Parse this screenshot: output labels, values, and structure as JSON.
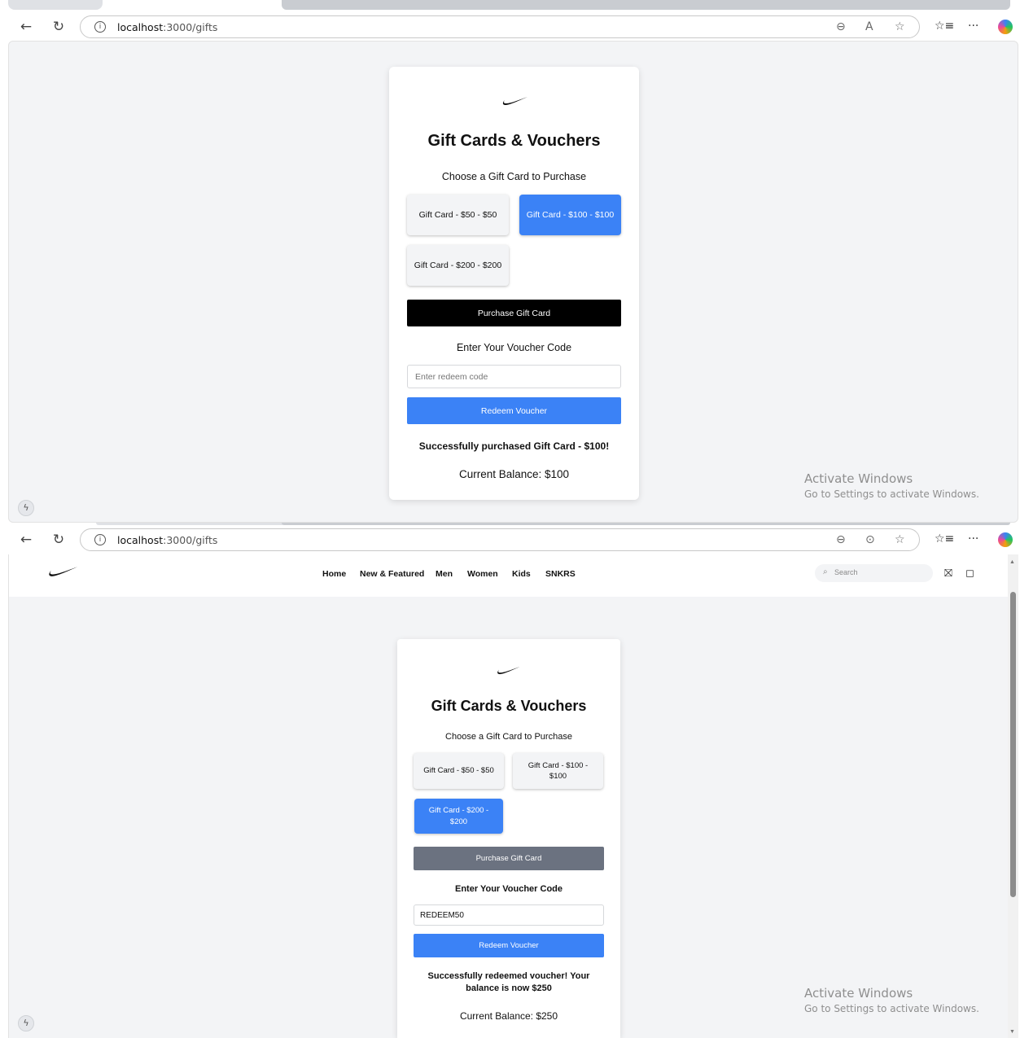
{
  "browser_top": {
    "url_host": "localhost",
    "url_path": ":3000/gifts"
  },
  "browser_bottom": {
    "url_host": "localhost",
    "url_path": ":3000/gifts"
  },
  "panel_top": {
    "title": "Gift Cards & Vouchers",
    "choose_label": "Choose a Gift Card to Purchase",
    "gift_cards": [
      {
        "label": "Gift Card - $50 - $50",
        "selected": false
      },
      {
        "label": "Gift Card - $100 - $100",
        "selected": true
      },
      {
        "label": "Gift Card - $200 - $200",
        "selected": false
      }
    ],
    "purchase_button": "Purchase Gift Card",
    "voucher_label": "Enter Your Voucher Code",
    "voucher_placeholder": "Enter redeem code",
    "voucher_value": "",
    "redeem_button": "Redeem Voucher",
    "message": "Successfully purchased Gift Card - $100!",
    "balance": "Current Balance: $100"
  },
  "site_nav": {
    "links": [
      "Home",
      "New & Featured",
      "Men",
      "Women",
      "Kids",
      "SNKRS"
    ],
    "search_placeholder": "Search"
  },
  "panel_bottom": {
    "title": "Gift Cards & Vouchers",
    "choose_label": "Choose a Gift Card to Purchase",
    "gift_cards": [
      {
        "label": "Gift Card - $50 - $50",
        "selected": false
      },
      {
        "label": "Gift Card - $100 - $100",
        "selected": false
      },
      {
        "label": "Gift Card - $200 - $200",
        "selected": true
      }
    ],
    "purchase_button": "Purchase Gift Card",
    "voucher_label": "Enter Your Voucher Code",
    "voucher_placeholder": "Enter redeem code",
    "voucher_value": "REDEEM50",
    "redeem_button": "Redeem Voucher",
    "message": "Successfully redeemed voucher! Your balance is now $250",
    "balance": "Current Balance: $250"
  },
  "watermark": {
    "line1": "Activate Windows",
    "line2": "Go to Settings to activate Windows."
  },
  "colors": {
    "accent_blue": "#3b82f6",
    "purchase_black": "#000000",
    "purchase_gray": "#6b7280",
    "page_bg": "#f3f4f6"
  }
}
